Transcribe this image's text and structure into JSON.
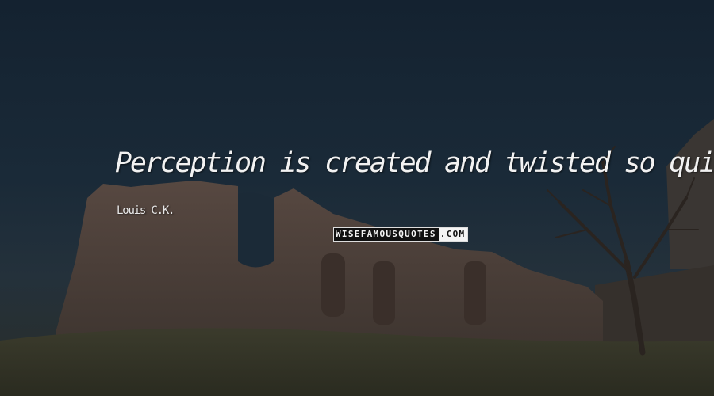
{
  "quote": {
    "text": "Perception is created and twisted so quickly."
  },
  "author": {
    "name": "Louis C.K."
  },
  "watermark": {
    "main": "WISEFAMOUSQUOTES",
    "tld": ".COM"
  },
  "colors": {
    "sky": "#1a2a38",
    "ruins": "#5a4a40",
    "grass": "#3a3a2a",
    "text": "#f2f2f2"
  }
}
